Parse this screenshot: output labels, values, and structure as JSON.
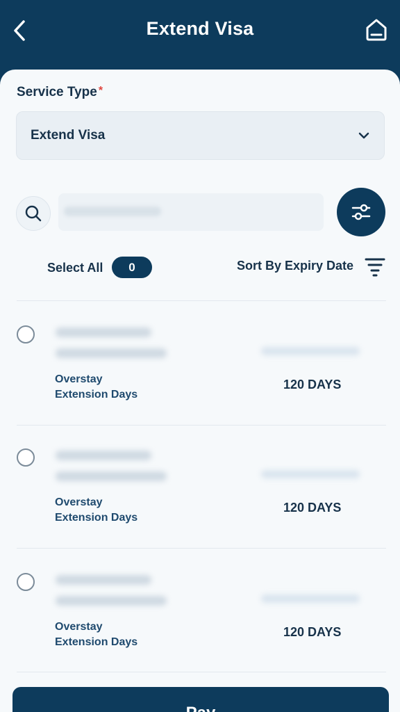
{
  "header": {
    "title": "Extend Visa"
  },
  "form": {
    "service_type_label": "Service Type",
    "required_mark": "*",
    "service_type_value": "Extend Visa"
  },
  "search": {
    "placeholder": ""
  },
  "selection": {
    "select_all_label": "Select All",
    "selected_count": "0",
    "sort_label": "Sort By Expiry Date"
  },
  "items": [
    {
      "label_line1": "Overstay",
      "label_line2": "Extension Days",
      "days": "120 DAYS"
    },
    {
      "label_line1": "Overstay",
      "label_line2": "Extension Days",
      "days": "120 DAYS"
    },
    {
      "label_line1": "Overstay",
      "label_line2": "Extension Days",
      "days": "120 DAYS"
    }
  ],
  "footer": {
    "pay_label": "Pay"
  },
  "colors": {
    "primary": "#0d3b5c",
    "background": "#f6f9fb",
    "required": "#e0463f"
  }
}
